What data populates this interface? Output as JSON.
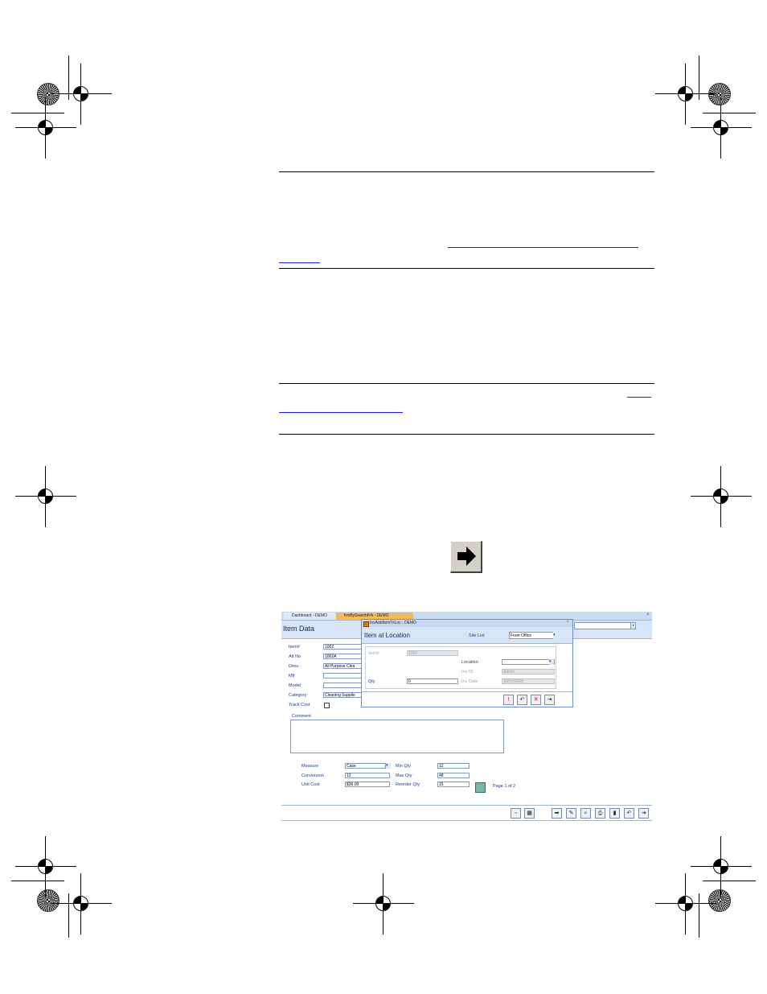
{
  "nav_icon": "right-arrow-icon",
  "app": {
    "tabs": [
      "Dashboard - DEMO",
      "frmBySearchFrk - DEMO"
    ],
    "form_title": "Item Data",
    "fields": {
      "item_label": "Item#",
      "item_value": "1002",
      "alt_label": "Alt No",
      "alt_value": "1002A",
      "desc_label": "Desc",
      "desc_value": "All Purpose Clea",
      "mfr_label": "Mfr",
      "model_label": "Model",
      "category_label": "Category",
      "category_value": "Cleaning Supplie",
      "track_label": "Track Cost",
      "comment_label": "Comment"
    },
    "bottom": {
      "measure_label": "Measure",
      "measure_value": "Case",
      "conversion_label": "Conversion",
      "conversion_value": "12",
      "unit_cost_label": "Unit Cost",
      "unit_cost_value": "$36.00",
      "min_label": "Min Qty",
      "min_value": "12",
      "max_label": "Max Qty",
      "max_value": "48",
      "reorder_label": "Reorder Qty",
      "reorder_value": "15",
      "page_text": "Page 1 of 2"
    },
    "dialog": {
      "window_title": "InvAddItemToLoc - DEMO",
      "title": "Item at Location",
      "site_label": "Site List",
      "site_value": "Front Office",
      "item_label": "Item#",
      "item_value": "1002",
      "location_label": "Location",
      "inv_id_label": "Inv ID",
      "inv_id_value": "Admin",
      "qty_label": "Qty",
      "qty_value": "0",
      "inv_date_label": "Inv Date",
      "inv_date_value": "10/31/2008"
    }
  }
}
